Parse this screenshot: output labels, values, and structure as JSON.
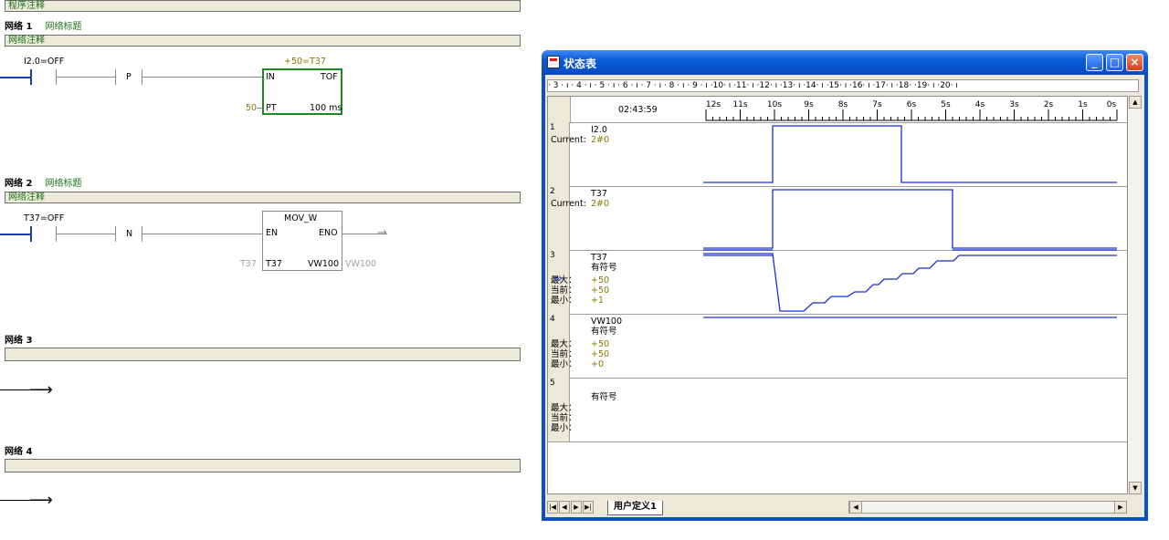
{
  "ladder": {
    "program_comment": "程序注释",
    "networks": [
      {
        "label": "网络 1",
        "title": "网络标题",
        "comment": "网络注释",
        "contact1": "I2.0=OFF",
        "contact2": "P",
        "block": {
          "param": "+50=T37",
          "in": "IN",
          "type": "TOF",
          "pt_val": "50",
          "pt": "PT",
          "res": "100 ms"
        }
      },
      {
        "label": "网络 2",
        "title": "网络标题",
        "comment": "网络注释",
        "contact1": "T37=OFF",
        "contact2": "N",
        "block": {
          "name": "MOV_W",
          "en": "EN",
          "eno": "ENO",
          "in_prefix": "T37",
          "in": "T37",
          "out": "VW100",
          "out_suffix": "VW100"
        }
      },
      {
        "label": "网络 3",
        "title": "",
        "comment": ""
      },
      {
        "label": "网络 4",
        "title": "",
        "comment": ""
      }
    ]
  },
  "status_chart": {
    "window_title": "状态表",
    "ruler": "· 3 · ı · 4 · ı · 5 · ı · 6 · ı · 7 · ı · 8 · ı · 9 · ı ·10· ı ·11· ı ·12· ı ·13· ı ·14· ı ·15· ı ·16· ı ·17· ı ·18·  ·19· ı ·20· ı",
    "time": "02:43:59",
    "time_axis": [
      "12s",
      "11s",
      "10s",
      "9s",
      "8s",
      "7s",
      "6s",
      "5s",
      "4s",
      "3s",
      "2s",
      "1s",
      "0s"
    ],
    "rows": [
      {
        "num": "1",
        "address": "I2.0",
        "format": "",
        "labels": [
          "Current:"
        ],
        "values": [
          "2#0"
        ]
      },
      {
        "num": "2",
        "address": "T37",
        "format": "",
        "labels": [
          "Current:"
        ],
        "values": [
          "2#0"
        ]
      },
      {
        "num": "3",
        "address": "T37",
        "format": "有符号",
        "labels": [
          "最大：",
          "当前：",
          "最小："
        ],
        "values": [
          "+50",
          "+50",
          "+1"
        ]
      },
      {
        "num": "4",
        "address": "VW100",
        "format": "有符号",
        "labels": [
          "最大：",
          "当前：",
          "最小："
        ],
        "values": [
          "+50",
          "+50",
          "+0"
        ]
      },
      {
        "num": "5",
        "address": "",
        "format": "有符号",
        "labels": [
          "最大：",
          "当前：",
          "最小："
        ],
        "values": [
          "",
          "",
          ""
        ]
      }
    ],
    "tab": "用户定义1",
    "trace_color": "#1a2fd6"
  }
}
